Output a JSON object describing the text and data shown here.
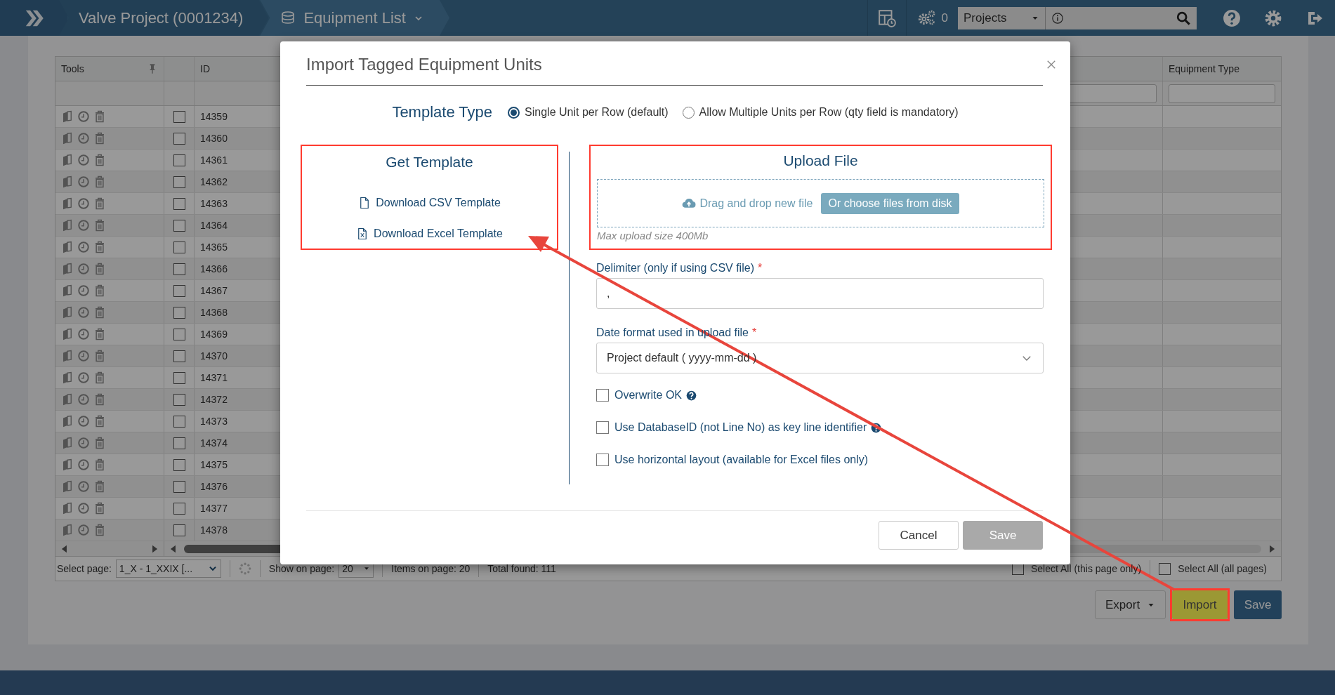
{
  "topbar": {
    "project": "Valve Project (0001234)",
    "page": "Equipment List",
    "jobs_count": "0",
    "scope_select": "Projects"
  },
  "table": {
    "columns": [
      "Tools",
      "ID",
      "Equipment Type"
    ],
    "rows": [
      {
        "id": "14359",
        "checked": false
      },
      {
        "id": "14360",
        "checked": false
      },
      {
        "id": "14361",
        "checked": false
      },
      {
        "id": "14362",
        "checked": false
      },
      {
        "id": "14363",
        "checked": false
      },
      {
        "id": "14364",
        "checked": false
      },
      {
        "id": "14365",
        "checked": false
      },
      {
        "id": "14366",
        "checked": false
      },
      {
        "id": "14367",
        "checked": false
      },
      {
        "id": "14368",
        "checked": false
      },
      {
        "id": "14369",
        "checked": false
      },
      {
        "id": "14370",
        "checked": false
      },
      {
        "id": "14371",
        "checked": false
      },
      {
        "id": "14372",
        "checked": false
      },
      {
        "id": "14373",
        "checked": false
      },
      {
        "id": "14374",
        "checked": false
      },
      {
        "id": "14375",
        "checked": false
      },
      {
        "id": "14376",
        "checked": false
      },
      {
        "id": "14377",
        "checked": false
      },
      {
        "id": "14378",
        "checked": false
      }
    ],
    "footer": {
      "select_page_label": "Select page:",
      "page_select": "1_X - 1_XXIX [...",
      "show_label": "Show on page:",
      "show_select": "20",
      "items_on_page": "Items on page: 20",
      "total_found": "Total found: 111",
      "select_all": [
        {
          "label": "Select All (this page only)",
          "checked": false
        },
        {
          "label": "Select All (all pages)",
          "checked": false
        }
      ]
    }
  },
  "actions": [
    {
      "label": "Export",
      "kind": "dropdown",
      "highlighted": false
    },
    {
      "label": "Import",
      "kind": "accent",
      "highlighted": true
    },
    {
      "label": "Save",
      "kind": "primary",
      "highlighted": false
    }
  ],
  "dialog": {
    "title": "Import Tagged Equipment Units",
    "template_type": {
      "label": "Template Type",
      "options": [
        {
          "label": "Single Unit per Row (default)",
          "selected": true
        },
        {
          "label": "Allow Multiple Units per Row (qty field is mandatory)",
          "selected": false
        }
      ]
    },
    "get_template": {
      "title": "Get Template",
      "highlighted": true,
      "links": [
        {
          "label": "Download CSV Template",
          "kind": "csv"
        },
        {
          "label": "Download Excel Template",
          "kind": "excel"
        }
      ]
    },
    "upload": {
      "title": "Upload File",
      "highlighted": true,
      "drop_text": "Drag and drop new file",
      "choose_button": "Or choose files from disk",
      "hint": "Max upload size 400Mb"
    },
    "fields": [
      {
        "label": "Delimiter (only if using CSV file)",
        "required_mark": "*",
        "kind": "text",
        "value": ","
      },
      {
        "label": "Date format used in upload file",
        "required_mark": "*",
        "kind": "select",
        "value": "Project default ( yyyy-mm-dd )"
      }
    ],
    "options": [
      {
        "label": "Overwrite OK",
        "checked": false,
        "help": true
      },
      {
        "label": "Use DatabaseID (not Line No) as key line identifier",
        "checked": false,
        "help": true
      },
      {
        "label": "Use horizontal layout (available for Excel files only)",
        "checked": false,
        "help": false
      }
    ],
    "buttons": [
      {
        "label": "Cancel",
        "disabled": false
      },
      {
        "label": "Save",
        "disabled": true
      }
    ]
  }
}
